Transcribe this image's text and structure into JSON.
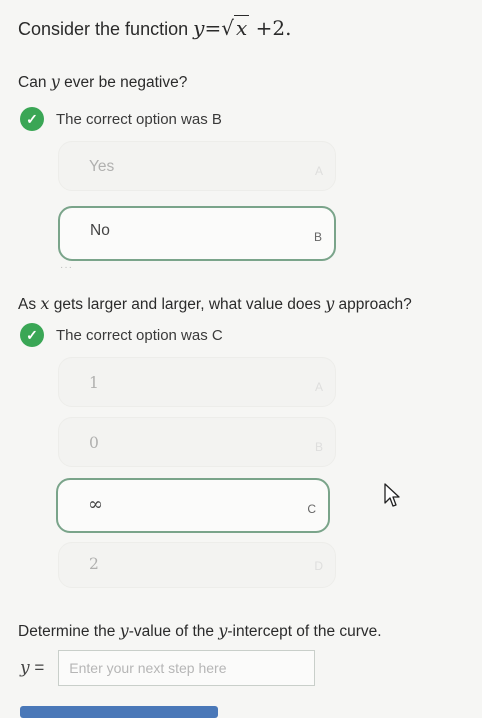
{
  "header": {
    "prefix": "Consider the function",
    "equation_lhs": "y",
    "equation_eq": "=",
    "sqrt_symbol": "√",
    "sqrt_arg": "x",
    "equation_rest": "+2."
  },
  "q1": {
    "text_pre": "Can",
    "var": "y",
    "text_post": "ever be negative?",
    "feedback": "The correct option was B",
    "options": [
      {
        "text": "Yes",
        "letter": "A"
      },
      {
        "text": "No",
        "letter": "B"
      }
    ],
    "dots": "···"
  },
  "q2": {
    "text_a": "As",
    "var_x": "x",
    "text_b": "gets larger and larger, what value does",
    "var_y": "y",
    "text_c": "approach?",
    "feedback": "The correct option was C",
    "options": [
      {
        "text": "1",
        "letter": "A"
      },
      {
        "text": "0",
        "letter": "B"
      },
      {
        "text": "∞",
        "letter": "C"
      },
      {
        "text": "2",
        "letter": "D"
      }
    ]
  },
  "q3": {
    "text_a": "Determine the",
    "var_y1": "y",
    "text_b": "-value of the",
    "var_y2": "y",
    "text_c": "-intercept of the curve.",
    "input_label_var": "y",
    "input_label_eq": "=",
    "placeholder": "Enter your next step here",
    "value": ""
  },
  "colors": {
    "check": "#3aa655",
    "selected_border": "#7aa48a",
    "button": "#4a78b8"
  }
}
